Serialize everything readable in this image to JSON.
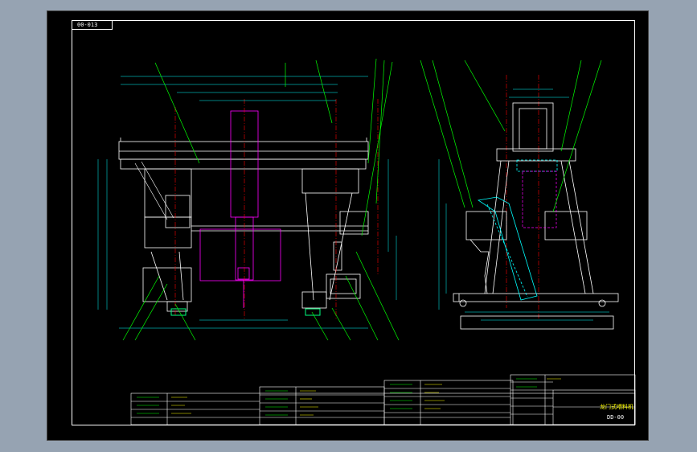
{
  "drawing": {
    "corner_code": "00-013",
    "title": "龙门式喂料机",
    "drawing_no": "DD-00",
    "colors": {
      "background": "#000000",
      "frame": "#ffffff",
      "structure": "#ffffff",
      "leaders": "#00ff00",
      "hidden": "#ff00ff",
      "centerline": "#ff0000",
      "conveyor": "#00ffff",
      "dims": "#00ffff"
    }
  }
}
